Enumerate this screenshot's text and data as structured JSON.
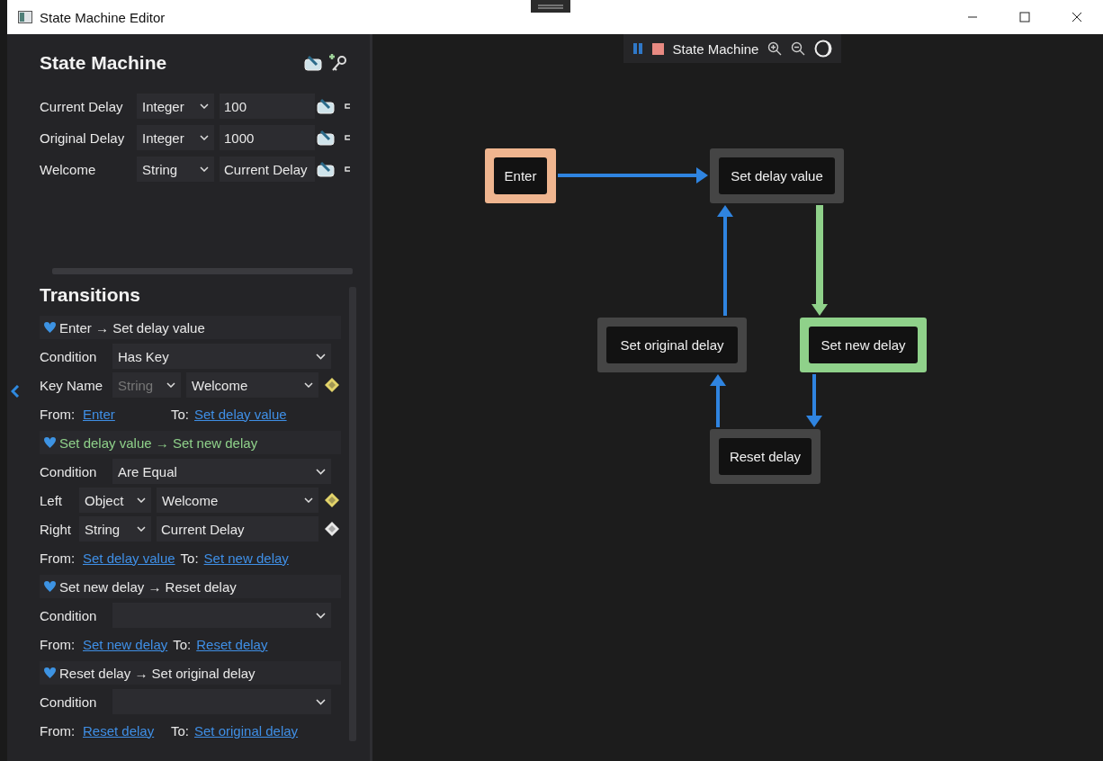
{
  "window": {
    "title": "State Machine Editor"
  },
  "state_machine": {
    "title": "State Machine",
    "variables": [
      {
        "name": "Current Delay",
        "type": "Integer",
        "value": "100"
      },
      {
        "name": "Original Delay",
        "type": "Integer",
        "value": "1000"
      },
      {
        "name": "Welcome",
        "type": "String",
        "value": "Current Delay"
      }
    ]
  },
  "transitions": {
    "title": "Transitions",
    "items": [
      {
        "label": "Enter → Set delay value",
        "active": false,
        "condition": {
          "label": "Condition",
          "value": "Has Key"
        },
        "params": [
          {
            "label": "Key Name",
            "type": "String",
            "type_disabled": true,
            "value": "Welcome",
            "kind": "dropdown",
            "color": "#e2d36a"
          }
        ],
        "from_label": "From:",
        "from": "Enter",
        "to_label": "To:",
        "to": "Set delay value"
      },
      {
        "label": "Set delay value → Set new delay",
        "active": true,
        "condition": {
          "label": "Condition",
          "value": "Are Equal"
        },
        "params": [
          {
            "label": "Left",
            "type": "Object",
            "type_disabled": false,
            "value": "Welcome",
            "kind": "dropdown",
            "color": "#e2d36a"
          },
          {
            "label": "Right",
            "type": "String",
            "type_disabled": false,
            "value": "Current Delay",
            "kind": "field",
            "color": "#e8e8e8"
          }
        ],
        "from_label": "From:",
        "from": "Set delay value",
        "to_label": "To:",
        "to": "Set new delay"
      },
      {
        "label": "Set new delay → Reset delay",
        "active": false,
        "condition": {
          "label": "Condition"
        },
        "from_label": "From:",
        "from": "Set new delay",
        "to_label": "To:",
        "to": "Reset delay"
      },
      {
        "label": "Reset delay → Set original delay",
        "active": false,
        "condition": {
          "label": "Condition"
        },
        "from_label": "From:",
        "from": "Reset delay",
        "to_label": "To:",
        "to": "Set original delay"
      }
    ]
  },
  "toolbar": {
    "title": "State Machine"
  },
  "graph": {
    "nodes": [
      {
        "label": "Enter",
        "kind": "entry",
        "active": false
      },
      {
        "label": "Set delay value",
        "kind": "state",
        "active": false
      },
      {
        "label": "Set original delay",
        "kind": "state",
        "active": false
      },
      {
        "label": "Set new delay",
        "kind": "state",
        "active": true
      },
      {
        "label": "Reset delay",
        "kind": "state",
        "active": false
      }
    ],
    "edges": [
      {
        "active": false
      },
      {
        "active": true
      },
      {
        "active": false
      },
      {
        "active": false
      },
      {
        "active": false
      }
    ]
  }
}
